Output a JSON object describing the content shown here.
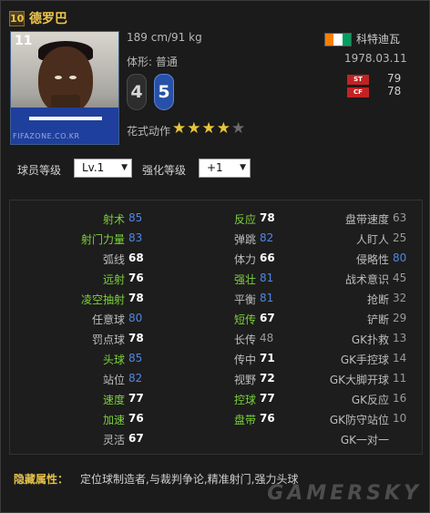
{
  "player": {
    "rating": "10",
    "name": "德罗巴",
    "number": "11",
    "photo_watermark": "FIFAZONE.CO.KR",
    "height_weight": "189 cm/91 kg",
    "body_type": "体形: 普通",
    "weak_foot_left": "4",
    "weak_foot_right": "5",
    "skill_moves_label": "花式动作",
    "skill_stars": 4,
    "skill_stars_max": 5,
    "nation": "科特迪瓦",
    "nation_flag_colors": [
      "#f77f00",
      "#ffffff",
      "#009e60"
    ],
    "birthdate": "1978.03.11",
    "positions": [
      {
        "code": "ST",
        "rating": "79"
      },
      {
        "code": "CF",
        "rating": "78"
      }
    ]
  },
  "controls": {
    "player_level_label": "球员等级",
    "player_level_value": "Lv.1",
    "enhance_level_label": "强化等级",
    "enhance_level_value": "+1"
  },
  "stats": {
    "col1": [
      {
        "label": "射术",
        "value": "85",
        "label_color": "green",
        "value_style": "blue"
      },
      {
        "label": "射门力量",
        "value": "83",
        "label_color": "green",
        "value_style": "blue"
      },
      {
        "label": "弧线",
        "value": "68",
        "label_color": "gray",
        "value_style": "white"
      },
      {
        "label": "远射",
        "value": "76",
        "label_color": "green",
        "value_style": "white"
      },
      {
        "label": "凌空抽射",
        "value": "78",
        "label_color": "green",
        "value_style": "white"
      },
      {
        "label": "任意球",
        "value": "80",
        "label_color": "gray",
        "value_style": "blue"
      },
      {
        "label": "罚点球",
        "value": "78",
        "label_color": "gray",
        "value_style": "white"
      },
      {
        "label": "头球",
        "value": "85",
        "label_color": "green",
        "value_style": "blue"
      },
      {
        "label": "站位",
        "value": "82",
        "label_color": "gray",
        "value_style": "blue"
      },
      {
        "label": "速度",
        "value": "77",
        "label_color": "green",
        "value_style": "white"
      },
      {
        "label": "加速",
        "value": "76",
        "label_color": "green",
        "value_style": "white"
      },
      {
        "label": "灵活",
        "value": "67",
        "label_color": "gray",
        "value_style": "white"
      }
    ],
    "col2": [
      {
        "label": "反应",
        "value": "78",
        "label_color": "green",
        "value_style": "white"
      },
      {
        "label": "弹跳",
        "value": "82",
        "label_color": "gray",
        "value_style": "blue"
      },
      {
        "label": "体力",
        "value": "66",
        "label_color": "gray",
        "value_style": "white"
      },
      {
        "label": "强壮",
        "value": "81",
        "label_color": "green",
        "value_style": "blue"
      },
      {
        "label": "平衡",
        "value": "81",
        "label_color": "gray",
        "value_style": "blue"
      },
      {
        "label": "短传",
        "value": "67",
        "label_color": "green",
        "value_style": "white"
      },
      {
        "label": "长传",
        "value": "48",
        "label_color": "gray",
        "value_style": "dim"
      },
      {
        "label": "传中",
        "value": "71",
        "label_color": "gray",
        "value_style": "white"
      },
      {
        "label": "视野",
        "value": "72",
        "label_color": "gray",
        "value_style": "white"
      },
      {
        "label": "控球",
        "value": "77",
        "label_color": "green",
        "value_style": "white"
      },
      {
        "label": "盘带",
        "value": "76",
        "label_color": "green",
        "value_style": "white"
      }
    ],
    "col3": [
      {
        "label": "盘带速度",
        "value": "63",
        "label_color": "gray",
        "value_style": "dim"
      },
      {
        "label": "人盯人",
        "value": "25",
        "label_color": "gray",
        "value_style": "dim"
      },
      {
        "label": "侵略性",
        "value": "80",
        "label_color": "gray",
        "value_style": "blue"
      },
      {
        "label": "战术意识",
        "value": "45",
        "label_color": "gray",
        "value_style": "dim"
      },
      {
        "label": "抢断",
        "value": "32",
        "label_color": "gray",
        "value_style": "dim"
      },
      {
        "label": "铲断",
        "value": "29",
        "label_color": "gray",
        "value_style": "dim"
      },
      {
        "label": "GK扑救",
        "value": "13",
        "label_color": "gray",
        "value_style": "dim"
      },
      {
        "label": "GK手控球",
        "value": "14",
        "label_color": "gray",
        "value_style": "dim"
      },
      {
        "label": "GK大脚开球",
        "value": "11",
        "label_color": "gray",
        "value_style": "dim"
      },
      {
        "label": "GK反应",
        "value": "16",
        "label_color": "gray",
        "value_style": "dim"
      },
      {
        "label": "GK防守站位",
        "value": "10",
        "label_color": "gray",
        "value_style": "dim"
      },
      {
        "label": "GK一对一",
        "value": "",
        "label_color": "gray",
        "value_style": "dim"
      }
    ]
  },
  "hidden_traits": {
    "label": "隐藏属性：",
    "value": "定位球制造者,与裁判争论,精准射门,强力头球"
  },
  "watermark": "GAMERSKY"
}
